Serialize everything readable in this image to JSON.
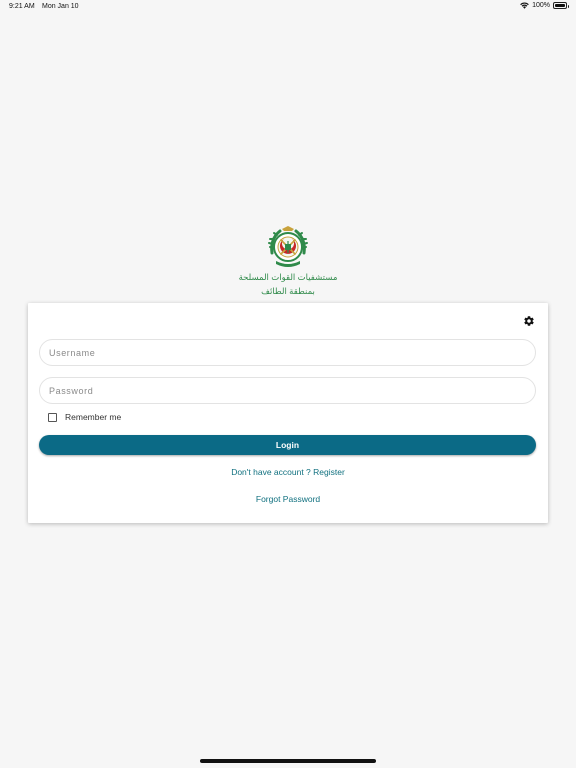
{
  "status_bar": {
    "time": "9:21 AM",
    "date": "Mon Jan 10",
    "battery": "100%",
    "battery_level": 1.0,
    "icons": [
      "wifi-icon",
      "battery-icon"
    ]
  },
  "branding": {
    "org_name_line1": "مستشفيات القوات المسلحة",
    "org_name_line2": "بمنطقة الطائف",
    "logo_icon": "armed-forces-hospital-emblem",
    "text_color": "#2f8a4a"
  },
  "login_form": {
    "settings_icon": "gear-icon",
    "username_placeholder": "Username",
    "username_value": "",
    "password_placeholder": "Password",
    "password_value": "",
    "remember_label": "Remember me",
    "remember_checked": false,
    "login_label": "Login",
    "register_link": "Don't have account ? Register",
    "forgot_link": "Forgot Password"
  },
  "colors": {
    "background": "#f6f6f6",
    "primary": "#0b6a86",
    "link": "#10707f"
  }
}
